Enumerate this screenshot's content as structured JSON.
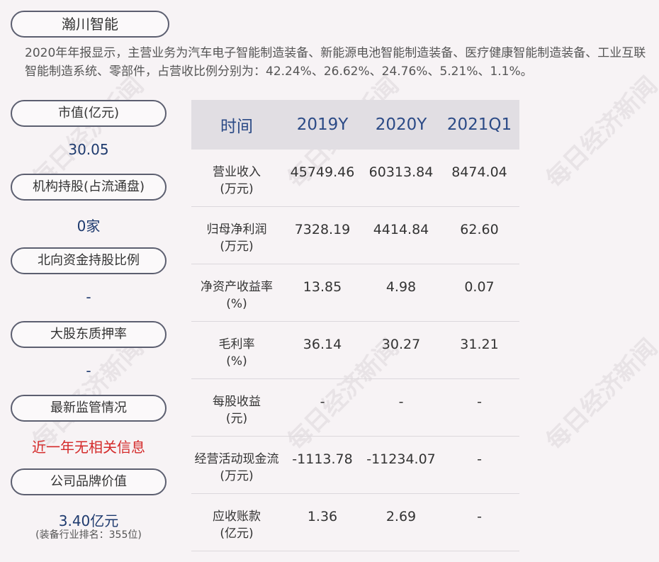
{
  "company": "瀚川智能",
  "summary": "2020年年报显示，主营业务为汽车电子智能制造装备、新能源电池智能制造装备、医疗健康智能制造装备、工业互联智能制造系统、零部件，占营收比例分别为：42.24%、26.62%、24.76%、5.21%、1.1%。",
  "left_panel": {
    "market_cap_label": "市值(亿元)",
    "market_cap_value": "30.05",
    "institution_label": "机构持股(占流通盘)",
    "institution_value": "0家",
    "northbound_label": "北向资金持股比例",
    "northbound_value": "-",
    "pledge_label": "大股东质押率",
    "pledge_value": "-",
    "regulation_label": "最新监管情况",
    "regulation_value": "近一年无相关信息",
    "brand_label": "公司品牌价值",
    "brand_value": "3.40亿元",
    "brand_rank": "(装备行业排名：355位)"
  },
  "table": {
    "headers": [
      "时间",
      "2019Y",
      "2020Y",
      "2021Q1"
    ],
    "rows": [
      {
        "label1": "营业收入",
        "label2": "(万元)",
        "values": [
          "45749.46",
          "60313.84",
          "8474.04"
        ]
      },
      {
        "label1": "归母净利润",
        "label2": "(万元)",
        "values": [
          "7328.19",
          "4414.84",
          "62.60"
        ]
      },
      {
        "label1": "净资产收益率",
        "label2": "(%)",
        "values": [
          "13.85",
          "4.98",
          "0.07"
        ]
      },
      {
        "label1": "毛利率",
        "label2": "(%)",
        "values": [
          "36.14",
          "30.27",
          "31.21"
        ]
      },
      {
        "label1": "每股收益",
        "label2": "(元)",
        "values": [
          "-",
          "-",
          "-"
        ]
      },
      {
        "label1": "经营活动现金流",
        "label2": "(万元)",
        "values": [
          "-1113.78",
          "-11234.07",
          "-"
        ]
      },
      {
        "label1": "应收账款",
        "label2": "(亿元)",
        "values": [
          "1.36",
          "2.69",
          "-"
        ]
      }
    ]
  },
  "watermark": "每日经济新闻"
}
